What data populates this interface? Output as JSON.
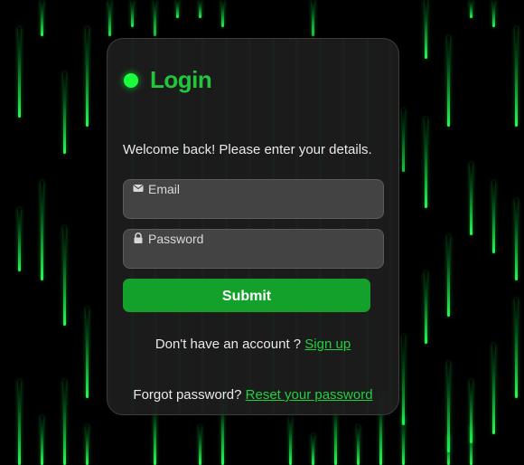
{
  "login": {
    "title": "Login",
    "subtitle": "Welcome back! Please enter your details.",
    "email": {
      "placeholder": "Email",
      "icon": "mail-icon"
    },
    "password": {
      "placeholder": "Password",
      "icon": "lock-icon"
    },
    "submit_label": "Submit",
    "signup_prompt": "Don't have an account ?",
    "signup_link": "Sign up",
    "forgot_prompt": "Forgot password?",
    "reset_link": "Reset your password"
  },
  "colors": {
    "background": "#000000",
    "accent": "#22c63d",
    "button": "#13a12c",
    "card": "#1e1e1e",
    "rain": "#22ff55"
  }
}
